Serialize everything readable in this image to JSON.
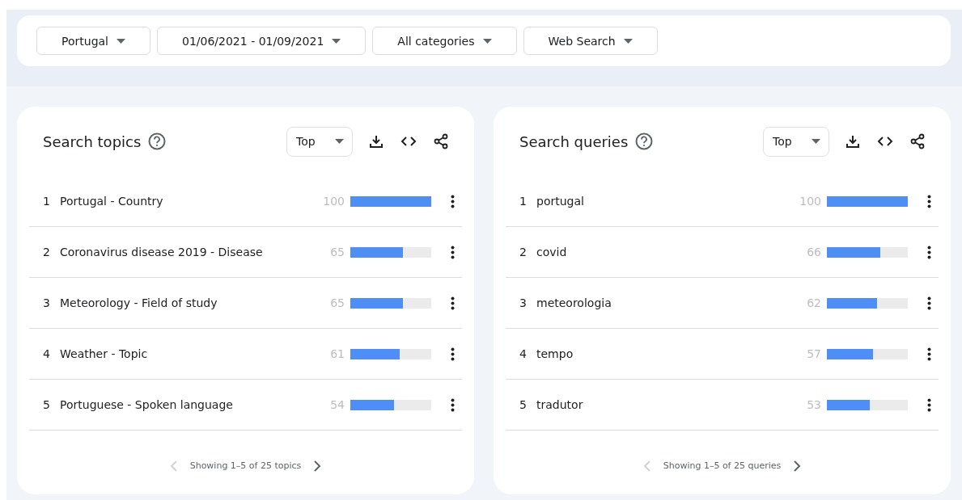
{
  "filters": [
    {
      "label": "Portugal"
    },
    {
      "label": "01/06/2021 - 01/09/2021"
    },
    {
      "label": "All categories"
    },
    {
      "label": "Web Search"
    }
  ],
  "panels": [
    {
      "title": "Search topics",
      "sort": "Top",
      "rows": [
        {
          "rank": "1",
          "label": "Portugal - Country",
          "value": "100",
          "level": 1.0
        },
        {
          "rank": "2",
          "label": "Coronavirus disease 2019 - Disease",
          "value": "65",
          "level": 0.65
        },
        {
          "rank": "3",
          "label": "Meteorology - Field of study",
          "value": "65",
          "level": 0.65
        },
        {
          "rank": "4",
          "label": "Weather - Topic",
          "value": "61",
          "level": 0.61
        },
        {
          "rank": "5",
          "label": "Portuguese - Spoken language",
          "value": "54",
          "level": 0.54
        }
      ],
      "pager": {
        "text": "Showing 1–5 of 25 topics",
        "prev_disabled": true,
        "next_disabled": false
      }
    },
    {
      "title": "Search queries",
      "sort": "Top",
      "rows": [
        {
          "rank": "1",
          "label": "portugal",
          "value": "100",
          "level": 1.0
        },
        {
          "rank": "2",
          "label": "covid",
          "value": "66",
          "level": 0.66
        },
        {
          "rank": "3",
          "label": "meteorologia",
          "value": "62",
          "level": 0.62
        },
        {
          "rank": "4",
          "label": "tempo",
          "value": "57",
          "level": 0.57
        },
        {
          "rank": "5",
          "label": "tradutor",
          "value": "53",
          "level": 0.53
        }
      ],
      "pager": {
        "text": "Showing 1–5 of 25 queries",
        "prev_disabled": true,
        "next_disabled": false
      }
    }
  ]
}
